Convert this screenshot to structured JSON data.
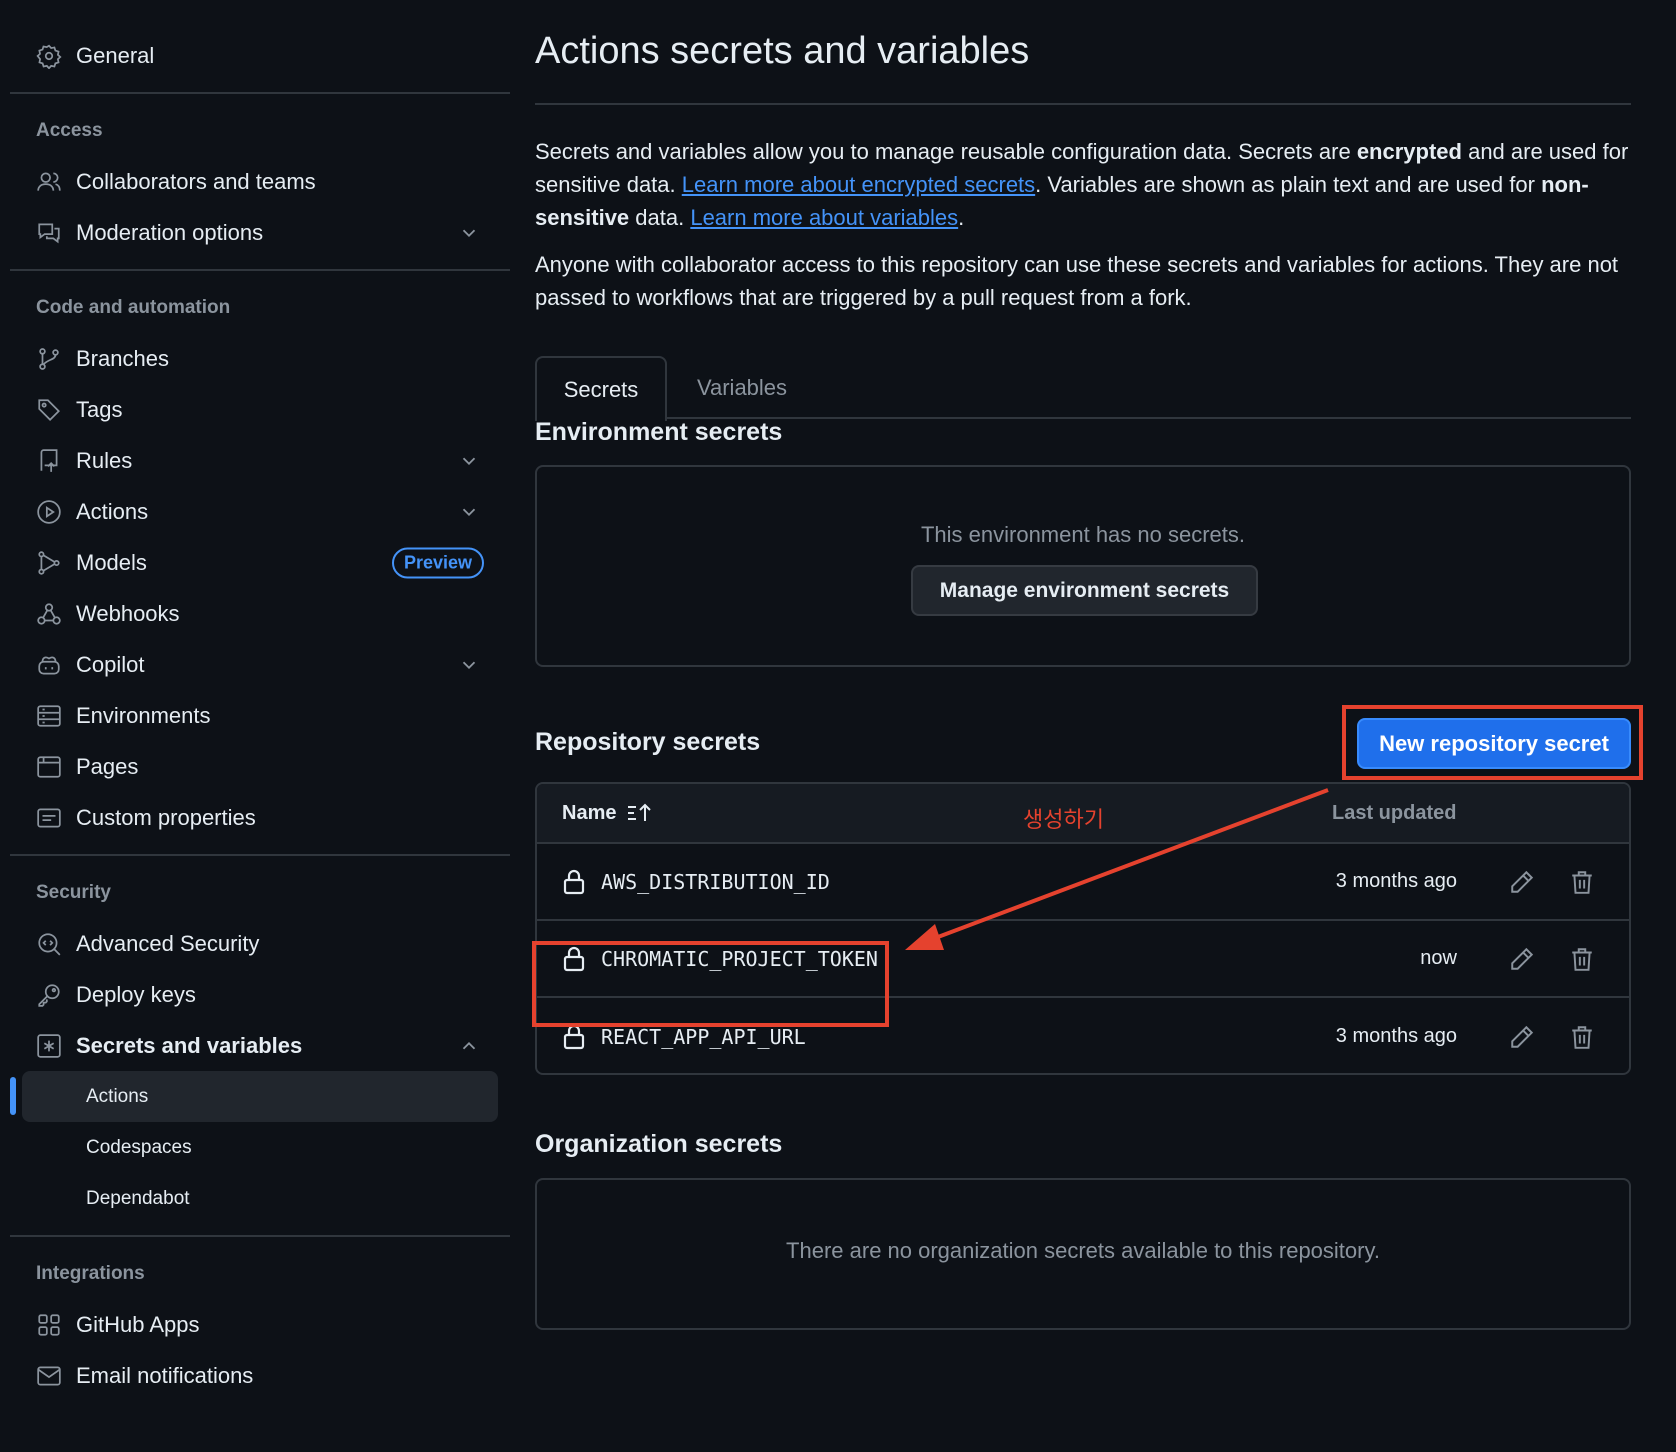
{
  "sidebar": {
    "general": "General",
    "sections": {
      "access": "Access",
      "code": "Code and automation",
      "security": "Security",
      "integrations": "Integrations"
    },
    "access_items": [
      "Collaborators and teams",
      "Moderation options"
    ],
    "code_items": [
      "Branches",
      "Tags",
      "Rules",
      "Actions",
      "Models",
      "Webhooks",
      "Copilot",
      "Environments",
      "Pages",
      "Custom properties"
    ],
    "models_badge": "Preview",
    "security_items": [
      "Advanced Security",
      "Deploy keys",
      "Secrets and variables"
    ],
    "secrets_sub": [
      "Actions",
      "Codespaces",
      "Dependabot"
    ],
    "integration_items": [
      "GitHub Apps",
      "Email notifications"
    ]
  },
  "main": {
    "title": "Actions secrets and variables",
    "intro": {
      "t1": "Secrets and variables allow you to manage reusable configuration data. Secrets are ",
      "b1": "encrypted",
      "t2": " and are used for sensitive data. ",
      "link1": "Learn more about encrypted secrets",
      "t3": ". Variables are shown as plain text and are used for ",
      "b2": "non-sensitive",
      "t4": " data. ",
      "link2": "Learn more about variables",
      "t5": "."
    },
    "notice": "Anyone with collaborator access to this repository can use these secrets and variables for actions. They are not passed to workflows that are triggered by a pull request from a fork.",
    "tabs": [
      "Secrets",
      "Variables"
    ],
    "environment": {
      "title": "Environment secrets",
      "empty": "This environment has no secrets.",
      "button": "Manage environment secrets"
    },
    "repository": {
      "title": "Repository secrets",
      "new_button": "New repository secret",
      "col_name": "Name",
      "col_updated": "Last updated",
      "annotation": "생성하기",
      "rows": [
        {
          "name": "AWS_DISTRIBUTION_ID",
          "updated": "3 months ago"
        },
        {
          "name": "CHROMATIC_PROJECT_TOKEN",
          "updated": "now"
        },
        {
          "name": "REACT_APP_API_URL",
          "updated": "3 months ago"
        }
      ]
    },
    "organization": {
      "title": "Organization secrets",
      "empty": "There are no organization secrets available to this repository."
    }
  },
  "colors": {
    "background": "#0d1117",
    "accent": "#1f6feb",
    "link": "#4493f8",
    "annotation_red": "#e5422e"
  }
}
